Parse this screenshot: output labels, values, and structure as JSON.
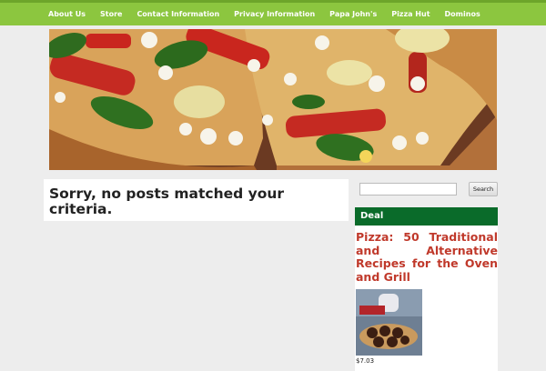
{
  "nav": {
    "items": [
      {
        "label": "About Us"
      },
      {
        "label": "Store"
      },
      {
        "label": "Contact Information"
      },
      {
        "label": "Privacy Information"
      },
      {
        "label": "Papa John's"
      },
      {
        "label": "Pizza Hut"
      },
      {
        "label": "Dominos"
      }
    ]
  },
  "main": {
    "message": "Sorry, no posts matched your criteria."
  },
  "sidebar": {
    "search": {
      "value": "",
      "button_label": "Search"
    },
    "widget_title": "Deal",
    "book": {
      "title": "Pizza: 50 Traditional and Alternative Recipes for the Oven and Grill",
      "price": "$7.03"
    }
  },
  "colors": {
    "nav_bg": "#8cc63f",
    "widget_header_bg": "#0a6b2a",
    "link": "#c0392b"
  }
}
